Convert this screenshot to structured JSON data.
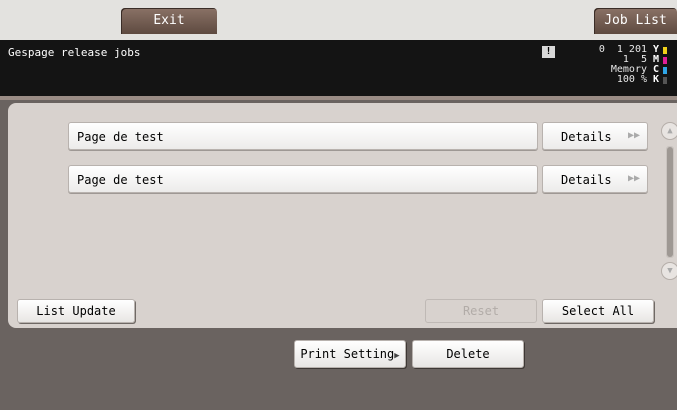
{
  "tabs": {
    "exit": "Exit",
    "job_list": "Job List"
  },
  "status": {
    "title": "Gespage release jobs",
    "warning_icon": "warning-icon",
    "counter_line1": "0  1 201",
    "counter_line2": "1  5",
    "memory_label": "Memory",
    "memory_value": "100 %",
    "toner": [
      {
        "letter": "Y",
        "color": "#f2d21a"
      },
      {
        "letter": "M",
        "color": "#e0209a"
      },
      {
        "letter": "C",
        "color": "#2fa6e8"
      },
      {
        "letter": "K",
        "color": "#555555"
      }
    ]
  },
  "jobs": [
    {
      "name": "Page de test",
      "details_label": "Details"
    },
    {
      "name": "Page de test",
      "details_label": "Details"
    }
  ],
  "buttons": {
    "list_update": "List Update",
    "reset": "Reset",
    "select_all": "Select All",
    "print_setting": "Print Setting",
    "delete": "Delete"
  },
  "icons": {
    "details_arrow": "double-chevron-right-icon",
    "scroll_up": "chevron-up-circle-icon",
    "scroll_down": "chevron-down-circle-icon"
  }
}
